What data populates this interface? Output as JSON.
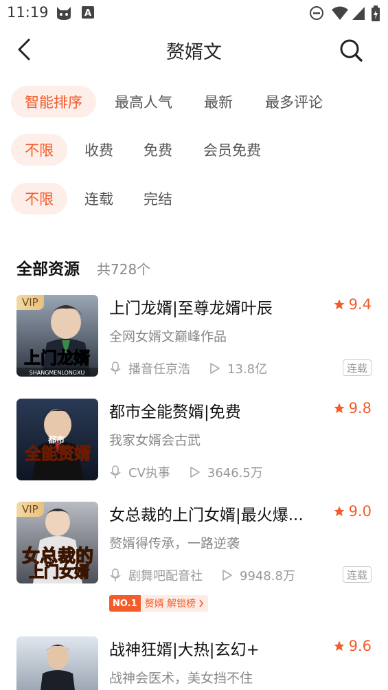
{
  "status_bar": {
    "time": "11:19",
    "icons": [
      "cat-face-icon",
      "a-box-icon",
      "do-not-disturb-icon",
      "wifi-icon",
      "signal-icon",
      "battery-icon"
    ]
  },
  "header": {
    "title": "赘婿文",
    "back_icon": "chevron-left-icon",
    "search_icon": "search-icon"
  },
  "filters": {
    "sort": [
      "智能排序",
      "最高人气",
      "最新",
      "最多评论"
    ],
    "price": [
      "不限",
      "收费",
      "免费",
      "会员免费"
    ],
    "status": [
      "不限",
      "连载",
      "完结"
    ]
  },
  "section": {
    "title": "全部资源",
    "count": "共728个"
  },
  "colors": {
    "accent": "#f25c2b",
    "chip_active_bg": "#fdeee9",
    "vip_gold": "#e8c07d"
  },
  "items": [
    {
      "title": "上门龙婿|至尊龙婿叶辰",
      "rating": "9.4",
      "desc": "全网女婿文巅峰作品",
      "narrator": "播音任京浩",
      "plays": "13.8亿",
      "vip": "VIP",
      "tag": "连载"
    },
    {
      "title": "都市全能赘婿|免费",
      "rating": "9.8",
      "desc": "我家女婿会古武",
      "narrator": "CV执事",
      "plays": "3646.5万"
    },
    {
      "title": "女总裁的上门女婿|最火爆...",
      "rating": "9.0",
      "desc": "赘婿得传承，一路逆袭",
      "narrator": "剧舞吧配音社",
      "plays": "9948.8万",
      "vip": "VIP",
      "tag": "连载",
      "rank_no": "NO.1",
      "rank_text": "赘婿 解锁榜"
    },
    {
      "title": "战神狂婿|大热|玄幻+",
      "rating": "9.6",
      "desc": "战神会医术，美女挡不住"
    }
  ]
}
